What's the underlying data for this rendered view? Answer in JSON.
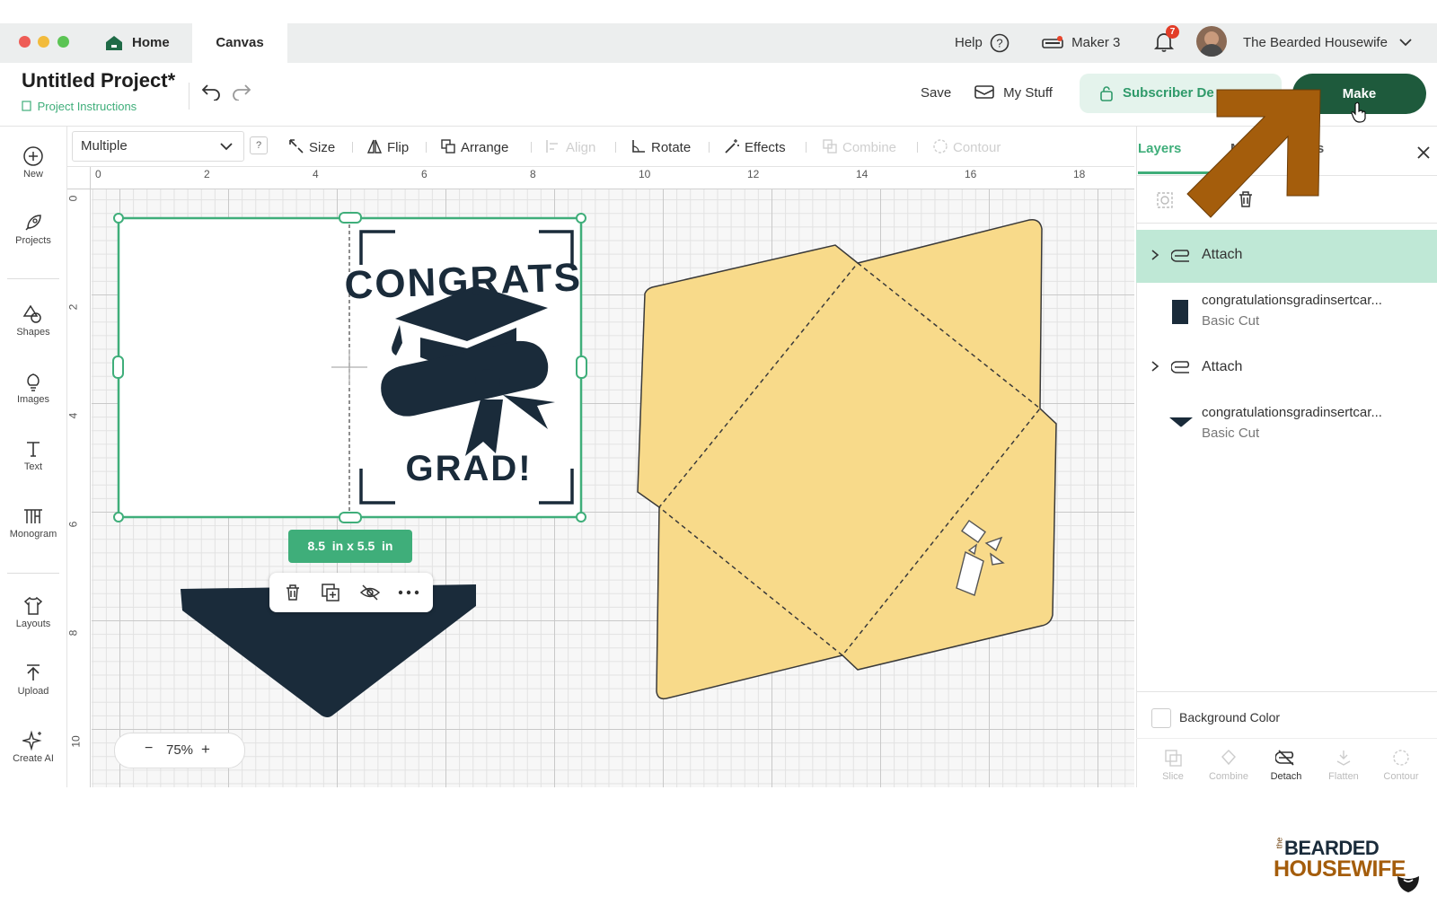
{
  "window": {
    "tabs": [
      {
        "label": "Home"
      },
      {
        "label": "Canvas"
      }
    ],
    "help_label": "Help",
    "machine_label": "Maker 3",
    "notification_count": "7",
    "user_name": "The Bearded Housewife"
  },
  "header": {
    "project_title": "Untitled Project*",
    "project_instructions": "Project Instructions",
    "save_label": "Save",
    "my_stuff_label": "My Stuff",
    "subscriber_label": "Subscriber De",
    "make_label": "Make"
  },
  "toolbar": {
    "select_value": "Multiple",
    "help_mark": "?",
    "size": "Size",
    "flip": "Flip",
    "arrange": "Arrange",
    "align": "Align",
    "rotate": "Rotate",
    "effects": "Effects",
    "combine": "Combine",
    "contour": "Contour"
  },
  "sidebar": {
    "items": [
      {
        "label": "New",
        "icon": "plus-circle-icon"
      },
      {
        "label": "Projects",
        "icon": "rocket-icon"
      },
      {
        "label": "Shapes",
        "icon": "shapes-icon"
      },
      {
        "label": "Images",
        "icon": "bulb-icon"
      },
      {
        "label": "Text",
        "icon": "text-icon"
      },
      {
        "label": "Monogram",
        "icon": "monogram-icon"
      },
      {
        "label": "Layouts",
        "icon": "shirt-icon"
      },
      {
        "label": "Upload",
        "icon": "upload-icon"
      },
      {
        "label": "Create AI",
        "icon": "sparkle-icon"
      }
    ]
  },
  "rulers": {
    "top": [
      "0",
      "2",
      "4",
      "6",
      "8",
      "10",
      "12",
      "14",
      "16",
      "18"
    ],
    "left": [
      "0",
      "2",
      "4",
      "6",
      "8",
      "10"
    ]
  },
  "canvas": {
    "size_badge": "8.5  in x 5.5  in",
    "zoom": "75%",
    "card_text_top": "CONGRATS",
    "card_text_bottom": "GRAD!"
  },
  "panel": {
    "tabs": [
      {
        "label": "Layers"
      },
      {
        "label": "M"
      },
      {
        "label": "rs"
      }
    ],
    "layers": [
      {
        "type": "group",
        "label": "Attach",
        "selected": true
      },
      {
        "type": "item",
        "name": "congratulationsgradinsertcar...",
        "op": "Basic Cut",
        "swatch": "#1a2b3a"
      },
      {
        "type": "group",
        "label": "Attach",
        "selected": false
      },
      {
        "type": "item",
        "name": "congratulationsgradinsertcar...",
        "op": "Basic Cut",
        "swatch": "#1a2b3a"
      }
    ],
    "background_color_label": "Background Color",
    "bottom_actions": [
      {
        "label": "Slice",
        "enabled": false
      },
      {
        "label": "Combine",
        "enabled": false
      },
      {
        "label": "Detach",
        "enabled": true
      },
      {
        "label": "Flatten",
        "enabled": false
      },
      {
        "label": "Contour",
        "enabled": false
      }
    ]
  },
  "colors": {
    "accent_green": "#3fae7a",
    "make_button": "#1e5a3c",
    "envelope": "#f8da8a",
    "navy": "#1a2b3a",
    "arrow": "#a45d0c"
  },
  "watermark": {
    "small": "the",
    "line1": "BEARDED",
    "line2": "HOUSEWIFE"
  }
}
